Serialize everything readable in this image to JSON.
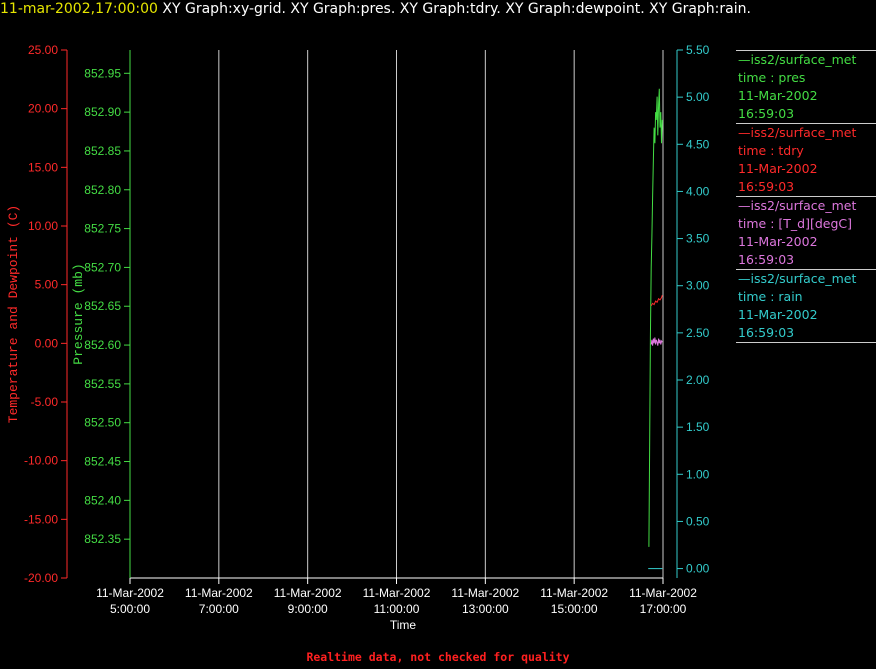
{
  "header": {
    "timestamp": "11-mar-2002,17:00:00",
    "graphs": "XY Graph:xy-grid.  XY Graph:pres.  XY Graph:tdry.  XY Graph:dewpoint.  XY Graph:rain."
  },
  "colors": {
    "background": "#000000",
    "temperature_axis": "#ff2a2a",
    "pressure_axis": "#44dd44",
    "rain_axis": "#33cccc",
    "dewpoint": "#dd77dd",
    "grid": "#cccccc",
    "header_timestamp": "#e6e600"
  },
  "legend": [
    {
      "source": "iss2/surface_met",
      "field": "time : pres",
      "date": "11-Mar-2002",
      "time": "16:59:03",
      "color": "#44dd44"
    },
    {
      "source": "iss2/surface_met",
      "field": "time : tdry",
      "date": "11-Mar-2002",
      "time": "16:59:03",
      "color": "#ff2a2a"
    },
    {
      "source": "iss2/surface_met",
      "field": "time : [T_d][degC]",
      "date": "11-Mar-2002",
      "time": "16:59:03",
      "color": "#dd77dd"
    },
    {
      "source": "iss2/surface_met",
      "field": "time : rain",
      "date": "11-Mar-2002",
      "time": "16:59:03",
      "color": "#33cccc"
    }
  ],
  "footer": "Realtime data, not checked for quality",
  "chart_data": {
    "type": "line",
    "xlabel": "Time",
    "xlim": [
      "05:00",
      "17:00"
    ],
    "x_ticks": [
      {
        "date": "11-Mar-2002",
        "time": "5:00:00"
      },
      {
        "date": "11-Mar-2002",
        "time": "7:00:00"
      },
      {
        "date": "11-Mar-2002",
        "time": "9:00:00"
      },
      {
        "date": "11-Mar-2002",
        "time": "11:00:00"
      },
      {
        "date": "11-Mar-2002",
        "time": "13:00:00"
      },
      {
        "date": "11-Mar-2002",
        "time": "15:00:00"
      },
      {
        "date": "11-Mar-2002",
        "time": "17:00:00"
      }
    ],
    "x_ticks_hours": [
      5,
      7,
      9,
      11,
      13,
      15,
      17
    ],
    "vertical_grid": true,
    "y_axes": {
      "temperature": {
        "label": "Temperature and Dewpoint (C)",
        "ylim": [
          -20,
          25
        ],
        "ticks": [
          "-20.00",
          "-15.00",
          "-10.00",
          "-5.00",
          "0.00",
          "5.00",
          "10.00",
          "15.00",
          "20.00",
          "25.00"
        ],
        "tick_values": [
          -20,
          -15,
          -10,
          -5,
          0,
          5,
          10,
          15,
          20,
          25
        ]
      },
      "pressure": {
        "label": "Pressure (mb)",
        "ylim": [
          852.3,
          852.98
        ],
        "ticks": [
          "852.35",
          "852.40",
          "852.45",
          "852.50",
          "852.55",
          "852.60",
          "852.65",
          "852.70",
          "852.75",
          "852.80",
          "852.85",
          "852.90",
          "852.95"
        ],
        "tick_values": [
          852.35,
          852.4,
          852.45,
          852.5,
          852.55,
          852.6,
          852.65,
          852.7,
          852.75,
          852.8,
          852.85,
          852.9,
          852.95
        ]
      },
      "rain": {
        "label": "",
        "ylim": [
          -0.1,
          5.5
        ],
        "ticks": [
          "0.00",
          "0.50",
          "1.00",
          "1.50",
          "2.00",
          "2.50",
          "3.00",
          "3.50",
          "4.00",
          "4.50",
          "5.00",
          "5.50"
        ],
        "tick_values": [
          0,
          0.5,
          1,
          1.5,
          2,
          2.5,
          3,
          3.5,
          4,
          4.5,
          5,
          5.5
        ]
      }
    },
    "series": [
      {
        "name": "pres",
        "axis": "pressure",
        "color": "#44dd44",
        "x": [
          "16:41",
          "16:42",
          "16:43",
          "16:44",
          "16:45",
          "16:46",
          "16:47",
          "16:48",
          "16:49",
          "16:50",
          "16:51",
          "16:52",
          "16:53",
          "16:54",
          "16:55",
          "16:56",
          "16:57",
          "16:58",
          "16:59"
        ],
        "y": [
          852.34,
          852.48,
          852.61,
          852.7,
          852.74,
          852.79,
          852.84,
          852.88,
          852.86,
          852.9,
          852.89,
          852.92,
          852.87,
          852.91,
          852.93,
          852.88,
          852.9,
          852.86,
          852.89
        ]
      },
      {
        "name": "tdry",
        "axis": "temperature",
        "color": "#ff2a2a",
        "x": [
          "16:44",
          "16:46",
          "16:48",
          "16:50",
          "16:52",
          "16:54",
          "16:56",
          "16:58",
          "16:59"
        ],
        "y": [
          3.2,
          3.4,
          3.3,
          3.6,
          3.5,
          3.8,
          3.7,
          3.9,
          4.1
        ]
      },
      {
        "name": "[T_d][degC]",
        "axis": "temperature",
        "color": "#dd77dd",
        "x": [
          "16:44",
          "16:45",
          "16:46",
          "16:47",
          "16:48",
          "16:49",
          "16:50",
          "16:51",
          "16:52",
          "16:53",
          "16:54",
          "16:55",
          "16:56",
          "16:57",
          "16:58",
          "16:59"
        ],
        "y": [
          -0.1,
          0.3,
          -0.2,
          0.4,
          0.0,
          0.5,
          -0.1,
          0.3,
          0.1,
          -0.2,
          0.4,
          0.0,
          0.3,
          -0.1,
          0.2,
          0.1
        ]
      },
      {
        "name": "rain",
        "axis": "rain",
        "color": "#33cccc",
        "x": [
          "16:40",
          "16:59"
        ],
        "y": [
          0.0,
          0.0
        ]
      }
    ]
  }
}
